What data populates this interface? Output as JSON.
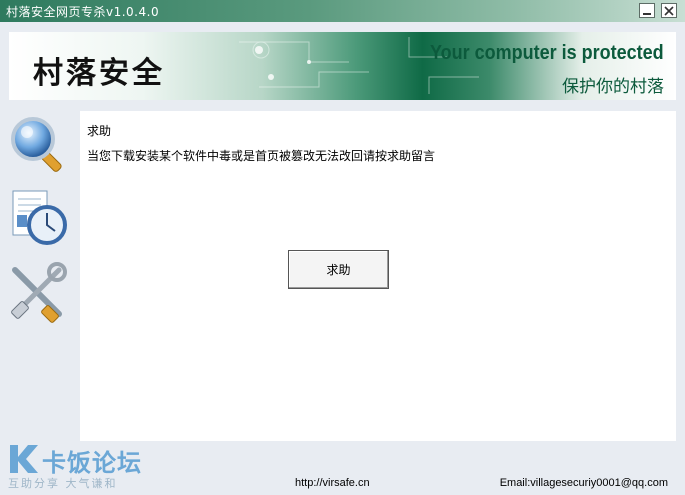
{
  "window": {
    "title": "村落安全网页专杀v1.0.4.0",
    "minimize_icon": "minimize-icon",
    "close_icon": "close-icon"
  },
  "banner": {
    "logo_text": "村落安全",
    "tagline": "Your computer is protected",
    "subtitle": "保护你的村落"
  },
  "sidebar": {
    "items": [
      {
        "icon": "magnifier-icon"
      },
      {
        "icon": "document-clock-icon"
      },
      {
        "icon": "tools-icon"
      }
    ]
  },
  "main": {
    "heading": "求助",
    "description": "当您下载安装某个软件中毒或是首页被篡改无法改回请按求助留言",
    "button_label": "求助"
  },
  "footer": {
    "url": "http://virsafe.cn",
    "email": "Email:villagesecuriy0001@qq.com"
  },
  "watermark": {
    "brand": "卡饭论坛",
    "slogan": "互助分享  大气谦和"
  },
  "colors": {
    "titlebar": "#2e7a5e",
    "banner_green": "#0c5a3c",
    "background": "#e8ecf2"
  }
}
